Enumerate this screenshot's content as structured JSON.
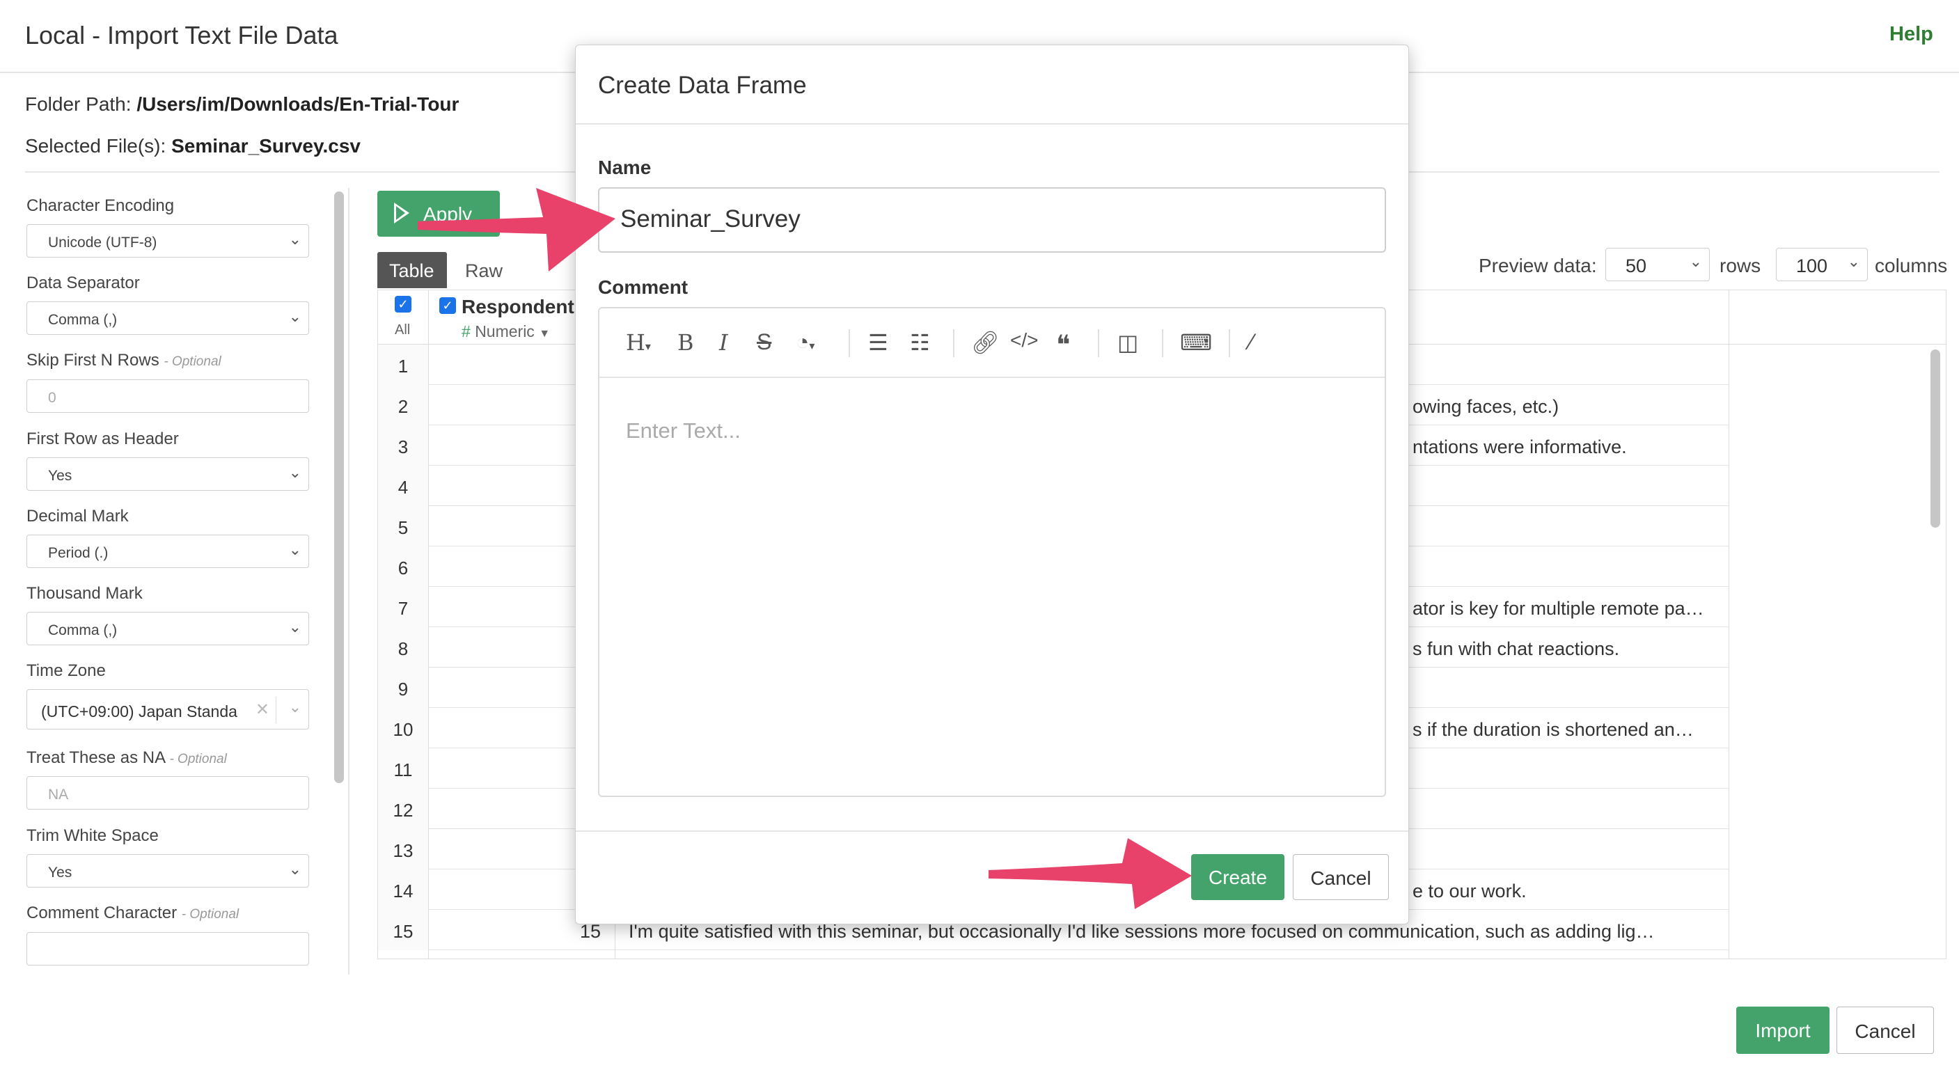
{
  "header": {
    "title": "Local - Import Text File Data",
    "help": "Help"
  },
  "info": {
    "folder_label": "Folder Path:",
    "folder_value": "/Users/im/Downloads/En-Trial-Tour",
    "file_label": "Selected File(s):",
    "file_value": "Seminar_Survey.csv"
  },
  "settings": {
    "encoding_label": "Character Encoding",
    "encoding_value": "Unicode (UTF-8)",
    "separator_label": "Data Separator",
    "separator_value": "Comma (,)",
    "skip_label": "Skip First N Rows",
    "skip_optional": "- Optional",
    "skip_placeholder": "0",
    "header_label": "First Row as Header",
    "header_value": "Yes",
    "decimal_label": "Decimal Mark",
    "decimal_value": "Period (.)",
    "thousand_label": "Thousand Mark",
    "thousand_value": "Comma (,)",
    "timezone_label": "Time Zone",
    "timezone_value": "(UTC+09:00) Japan Standa",
    "na_label": "Treat These as NA",
    "na_optional": "- Optional",
    "na_placeholder": "NA",
    "trim_label": "Trim White Space",
    "trim_value": "Yes",
    "comment_label": "Comment Character",
    "comment_optional": "- Optional"
  },
  "toolbar": {
    "apply": "Apply",
    "tab_table": "Table",
    "tab_raw": "Raw"
  },
  "preview": {
    "label": "Preview data:",
    "rows_value": "50",
    "rows_label": "rows",
    "cols_value": "100",
    "cols_label": "columns"
  },
  "table": {
    "all_label": "All",
    "col1_name": "Respondent",
    "col1_type": "Numeric",
    "rows": [
      {
        "n": "1",
        "text": ""
      },
      {
        "n": "2",
        "text": "owing faces, etc.)"
      },
      {
        "n": "3",
        "text": "ntations were informative."
      },
      {
        "n": "4",
        "text": ""
      },
      {
        "n": "5",
        "text": ""
      },
      {
        "n": "6",
        "text": ""
      },
      {
        "n": "7",
        "text": "ator is key for multiple remote pa…"
      },
      {
        "n": "8",
        "text": "s fun with chat reactions."
      },
      {
        "n": "9",
        "text": ""
      },
      {
        "n": "10",
        "text": "s if the duration is shortened an…"
      },
      {
        "n": "11",
        "text": ""
      },
      {
        "n": "12",
        "text": ""
      },
      {
        "n": "13",
        "text": ""
      },
      {
        "n": "14",
        "text": "e to our work."
      },
      {
        "n": "15",
        "text": "I'm quite satisfied with this seminar, but occasionally I'd like sessions more focused on communication, such as adding lig…",
        "val": "15"
      }
    ]
  },
  "footer": {
    "import": "Import",
    "cancel": "Cancel"
  },
  "modal": {
    "title": "Create Data Frame",
    "name_label": "Name",
    "name_value": "Seminar_Survey",
    "comment_label": "Comment",
    "comment_placeholder": "Enter Text...",
    "create": "Create",
    "cancel": "Cancel"
  },
  "colors": {
    "accent": "#43a36b",
    "arrow": "#e8426a",
    "help": "#2e7d32"
  }
}
